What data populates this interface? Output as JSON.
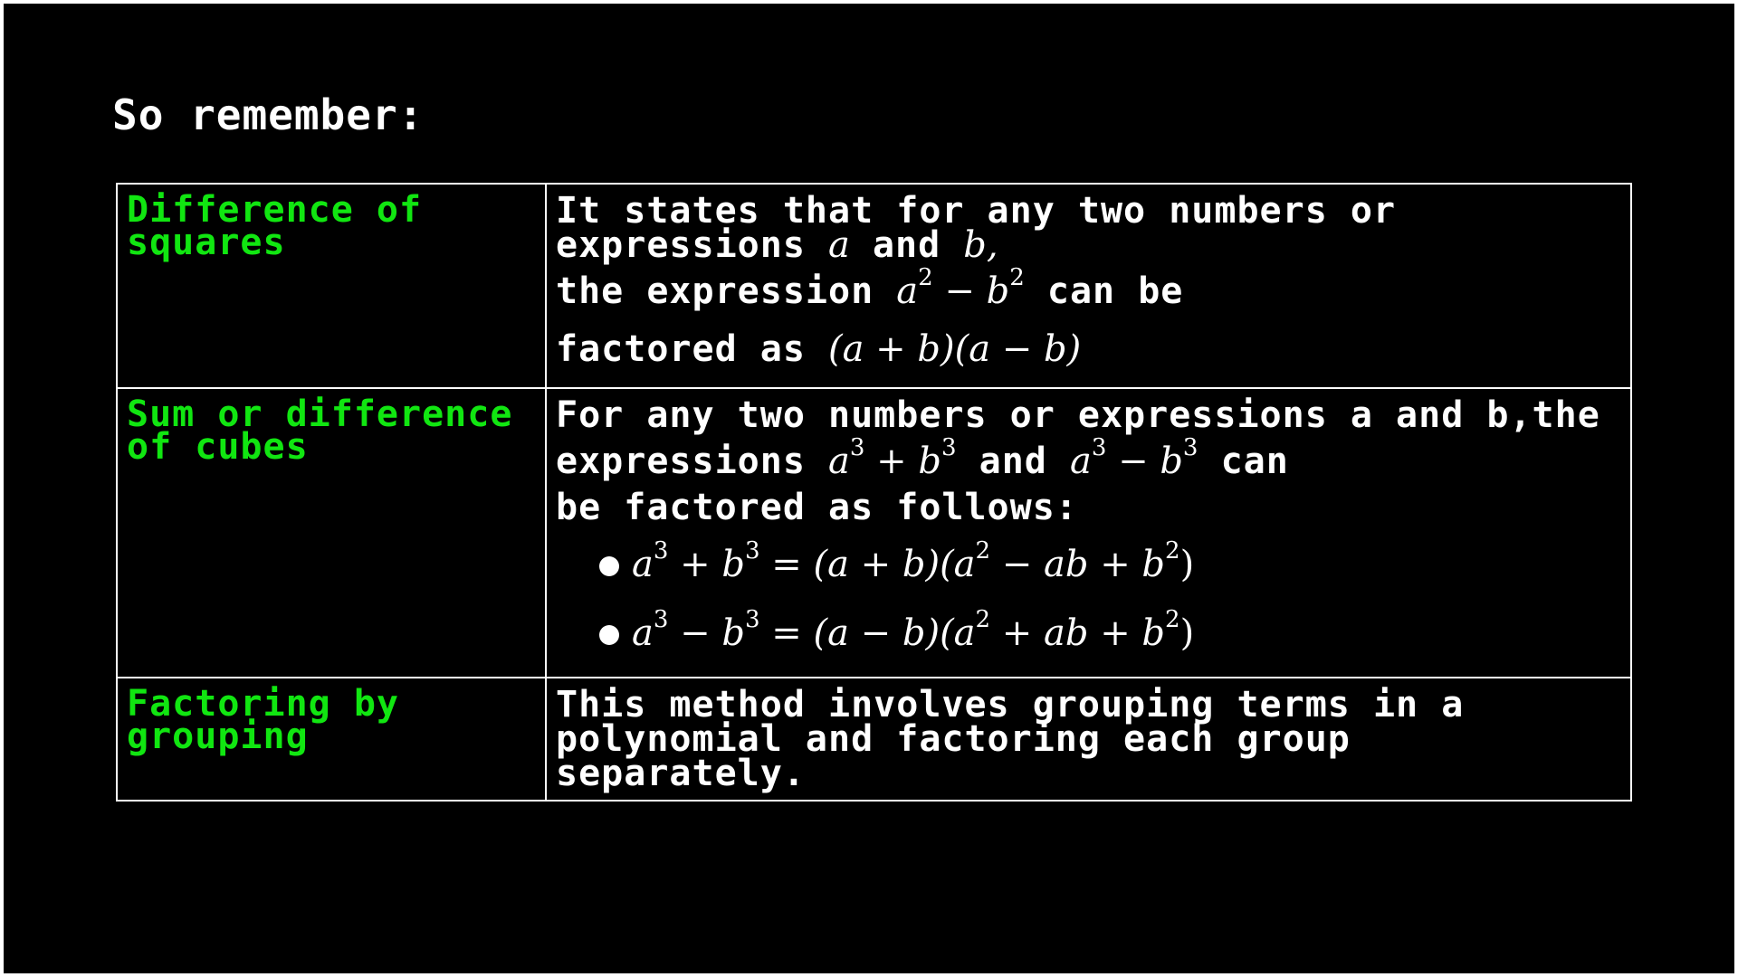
{
  "heading": "So remember:",
  "rows": [
    {
      "term": "Difference of squares",
      "desc_1": "It states that for any two numbers or expressions",
      "var_a": "a",
      "word_and": "and",
      "var_b": "b,",
      "desc_2": "the expression",
      "expr_1": "a",
      "exp_1": "2",
      "op_1": "−",
      "expr_2": "b",
      "exp_2": "2",
      "desc_3": "can be",
      "desc_4": "factored as",
      "factored": "(a + b)(a − b)"
    },
    {
      "term": "Sum or difference of cubes",
      "desc_1": "For any two numbers or expressions a and b,the",
      "desc_2": "expressions",
      "sum_a": "a",
      "sum_exp_a": "3",
      "sum_op": "+",
      "sum_b": "b",
      "sum_exp_b": "3",
      "word_and": "and",
      "diff_a": "a",
      "diff_exp_a": "3",
      "diff_op": "−",
      "diff_b": "b",
      "diff_exp_b": "3",
      "desc_3": "can",
      "desc_4": "be factored as follows:",
      "formula_1": {
        "a": "a",
        "e1": "3",
        "op": "+",
        "b": "b",
        "e2": "3",
        "rhs_1": "= (a + b)(a",
        "e3": "2",
        "rhs_2": "− ab + b",
        "e4": "2",
        "rhs_3": ")"
      },
      "formula_2": {
        "a": "a",
        "e1": "3",
        "op": "−",
        "b": "b",
        "e2": "3",
        "rhs_1": "= (a − b)(a",
        "e3": "2",
        "rhs_2": "+ ab + b",
        "e4": "2",
        "rhs_3": ")"
      }
    },
    {
      "term": "Factoring by grouping",
      "desc": "This method involves grouping terms in a polynomial and factoring each group separately."
    }
  ],
  "colors": {
    "background": "#000000",
    "term_text": "#11e611",
    "body_text": "#ffffff",
    "border": "#ffffff"
  }
}
